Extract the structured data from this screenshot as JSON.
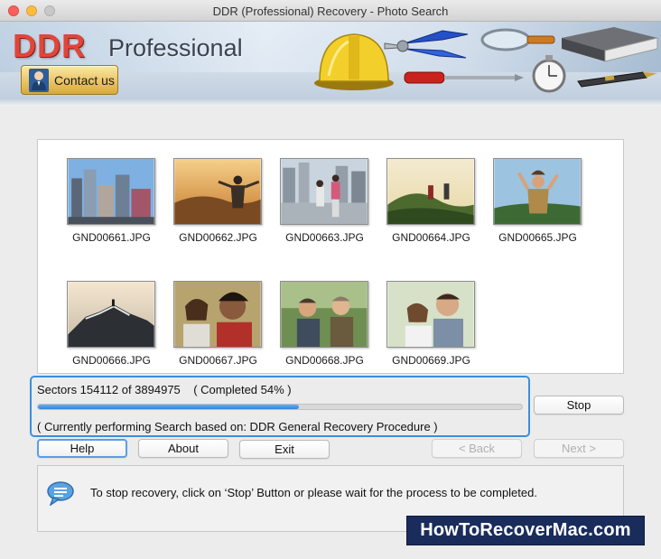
{
  "window": {
    "title": "DDR (Professional) Recovery - Photo Search"
  },
  "banner": {
    "logo_brand": "DDR",
    "logo_edition": "Professional",
    "contact_label": "Contact us"
  },
  "photos": [
    {
      "name": "GND00661.JPG"
    },
    {
      "name": "GND00662.JPG"
    },
    {
      "name": "GND00663.JPG"
    },
    {
      "name": "GND00664.JPG"
    },
    {
      "name": "GND00665.JPG"
    },
    {
      "name": "GND00666.JPG"
    },
    {
      "name": "GND00667.JPG"
    },
    {
      "name": "GND00668.JPG"
    },
    {
      "name": "GND00669.JPG"
    }
  ],
  "progress": {
    "sectors_text": "Sectors 154112 of 3894975    ( Completed 54% )",
    "percent": 54,
    "current_text": "( Currently performing Search based on: DDR General Recovery Procedure )"
  },
  "buttons": {
    "stop": "Stop",
    "help": "Help",
    "about": "About",
    "exit": "Exit",
    "back": "< Back",
    "next": "Next >"
  },
  "info": {
    "message": "To stop recovery, click on ‘Stop’ Button or please wait for the process to be completed."
  },
  "watermark": {
    "text": "HowToRecoverMac.com"
  },
  "colors": {
    "accent": "#3c8fdc",
    "brand_red": "#e2453a",
    "contact_gold": "#e8c160",
    "watermark_bg": "#1a2c5c"
  }
}
